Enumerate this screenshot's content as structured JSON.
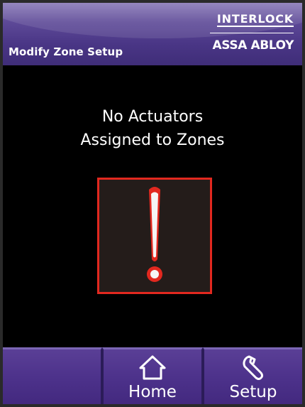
{
  "header": {
    "screen_title": "Modify Zone Setup",
    "brand_top": "INTERLOCK",
    "brand_bottom": "ASSA ABLOY"
  },
  "message": {
    "line1": "No Actuators",
    "line2": "Assigned to Zones"
  },
  "warning": {
    "icon": "exclamation-icon",
    "border_color": "#e2281f",
    "glyph_color": "#e2281f"
  },
  "nav": {
    "buttons": [
      {
        "label": "",
        "icon": ""
      },
      {
        "label": "Home",
        "icon": "home-icon"
      },
      {
        "label": "Setup",
        "icon": "wrench-icon"
      }
    ]
  },
  "colors": {
    "accent_purple": "#4c318a",
    "background": "#000000",
    "alert_red": "#e2281f"
  }
}
